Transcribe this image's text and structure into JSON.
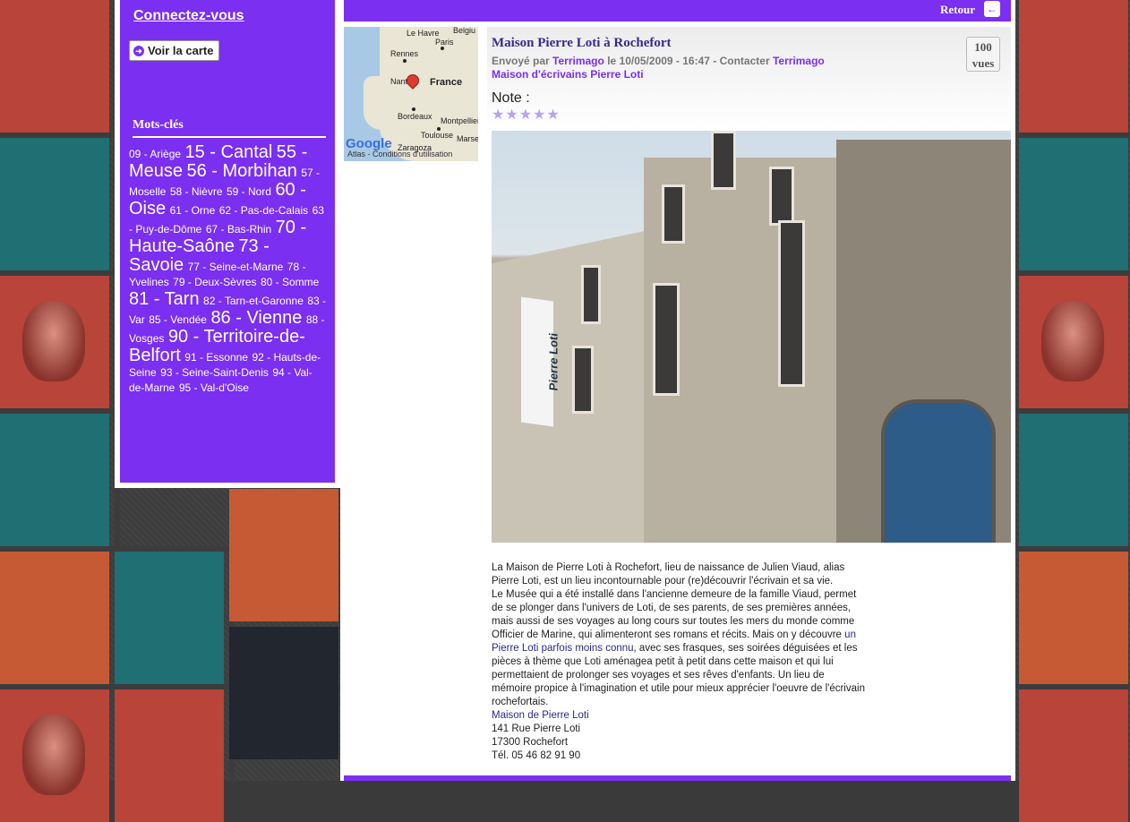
{
  "sidebar": {
    "connect_label": "Connectez-vous",
    "map_button_label": "Voir la carte",
    "keywords_title": "Mots-clés",
    "tags": [
      {
        "text": "09 - Ariège",
        "size": "sm"
      },
      {
        "text": "15 - Cantal",
        "size": "lg"
      },
      {
        "text": "55 - Meuse",
        "size": "lg"
      },
      {
        "text": "56 - Morbihan",
        "size": "lg"
      },
      {
        "text": "57 - Moselle",
        "size": "sm"
      },
      {
        "text": "58 - Nièvre",
        "size": "sm"
      },
      {
        "text": "59 - Nord",
        "size": "sm"
      },
      {
        "text": "60 - Oise",
        "size": "lg"
      },
      {
        "text": "61 - Orne",
        "size": "sm"
      },
      {
        "text": "62 - Pas-de-Calais",
        "size": "sm"
      },
      {
        "text": "63 - Puy-de-Dôme",
        "size": "sm"
      },
      {
        "text": "67 - Bas-Rhin",
        "size": "sm"
      },
      {
        "text": "70 - Haute-Saône",
        "size": "lg"
      },
      {
        "text": "73 - Savoie",
        "size": "lg"
      },
      {
        "text": "77 - Seine-et-Marne",
        "size": "sm"
      },
      {
        "text": "78 - Yvelines",
        "size": "sm"
      },
      {
        "text": "79 - Deux-Sèvres",
        "size": "sm"
      },
      {
        "text": "80 - Somme",
        "size": "sm"
      },
      {
        "text": "81 - Tarn",
        "size": "lg"
      },
      {
        "text": "82 - Tarn-et-Garonne",
        "size": "sm"
      },
      {
        "text": "83 - Var",
        "size": "sm"
      },
      {
        "text": "85 - Vendée",
        "size": "sm"
      },
      {
        "text": "86 - Vienne",
        "size": "lg"
      },
      {
        "text": "88 - Vosges",
        "size": "sm"
      },
      {
        "text": "90 - Territoire-de-Belfort",
        "size": "lg"
      },
      {
        "text": "91 - Essonne",
        "size": "sm"
      },
      {
        "text": "92 - Hauts-de-Seine",
        "size": "sm"
      },
      {
        "text": "93 - Seine-Saint-Denis",
        "size": "sm"
      },
      {
        "text": "94 - Val-de-Marne",
        "size": "sm"
      },
      {
        "text": "95 - Val-d'Oise",
        "size": "sm"
      }
    ]
  },
  "topbar": {
    "back_label": "Retour"
  },
  "map": {
    "cities": [
      "Le Havre",
      "Paris",
      "Rennes",
      "Nantes",
      "France",
      "Bordeaux",
      "Montpellier",
      "Toulouse",
      "Zaragoza",
      "Marseille",
      "Belgiu"
    ],
    "google_label": "Google",
    "attribution": "Atlas - Conditions d'utilisation"
  },
  "post": {
    "title": "Maison Pierre Loti à Rochefort",
    "sent_by_prefix": "Envoyé par",
    "author": "Terrimago",
    "date_text": "le 10/05/2009 - 16:47 - Contacter",
    "contact": "Terrimago",
    "category": "Maison d'écrivains Pierre Loti",
    "views": "100",
    "views_label": "vues",
    "note_label": "Note :",
    "stars": "★★★★★",
    "photo_sign": "Pierre Loti",
    "description_lines": [
      "La Maison de Pierre Loti à Rochefort, lieu de naissance de Julien Viaud, alias",
      "Pierre Loti, est un lieu incontournable pour (re)découvrir l'écrivain et sa vie.",
      "Le Musée qui a été installé dans l'ancienne demeure de la famille Viaud, permet",
      "de se plonger dans l'univers de Loti, de ses parents, de ses premières années,",
      "mais aussi de ses voyages au long cours sur toutes les mers du monde comme",
      "Officier de Marine, qui alimenteront ses romans et récits. Mais on y découvre"
    ],
    "desc_link_tail": "un",
    "desc_link_line": "Pierre Loti parfois moins connu",
    "desc_after_link": ", avec ses frasques, ses soirées déguisées et les",
    "description_lines2": [
      "pièces à thème que Loti aménagea petit à petit dans cette maison et qui lui",
      "permettaient de prolonger ses voyages et ses rêves d'enfants. Un lieu de",
      "mémoire propice à l'imagination et utile pour mieux apprécier l'oeuvre de l'écrivain",
      "rochefortais."
    ],
    "address_link": "Maison de Pierre Loti",
    "address_street": "141 Rue Pierre Loti",
    "address_city": "17300 Rochefort",
    "address_phone": "Tél. 05 46 82 91 90"
  }
}
